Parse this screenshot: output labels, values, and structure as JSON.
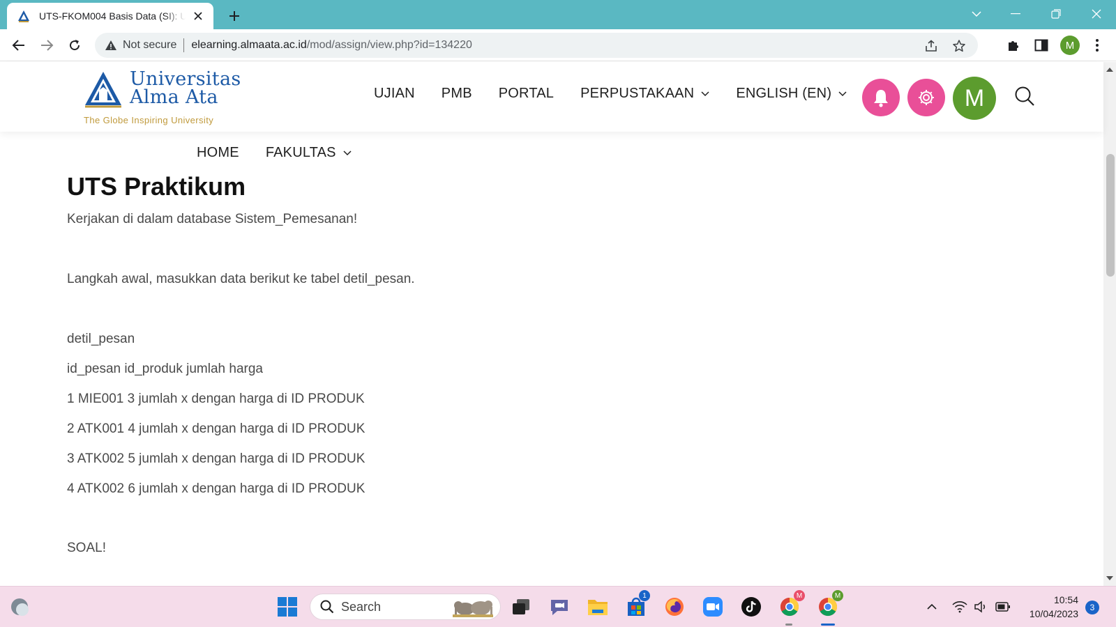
{
  "browser": {
    "tab_title": "UTS-FKOM004 Basis Data (SI): UTS Praktikum",
    "security_label": "Not secure",
    "url_host": "elearning.almaata.ac.id",
    "url_path": "/mod/assign/view.php?id=134220",
    "profile_initial": "M"
  },
  "site": {
    "logo_line1": "Universitas",
    "logo_line2": "Alma Ata",
    "logo_tagline": "The Globe Inspiring University",
    "nav": [
      {
        "label": "UJIAN"
      },
      {
        "label": "PMB"
      },
      {
        "label": "PORTAL"
      },
      {
        "label": "PERPUSTAKAAN"
      },
      {
        "label": "ENGLISH (EN)"
      }
    ],
    "user_initial": "M",
    "subnav": [
      {
        "label": "HOME"
      },
      {
        "label": "FAKULTAS"
      }
    ],
    "colors": {
      "accent_pink": "#e94f98",
      "avatar_green": "#5c9c2e",
      "brand_blue": "#1d5aa6"
    }
  },
  "content": {
    "title": "UTS Praktikum",
    "paragraphs": [
      "Kerjakan di dalam database Sistem_Pemesanan!",
      "Langkah awal, masukkan data berikut ke tabel detil_pesan.",
      "detil_pesan",
      "id_pesan  id_produk  jumlah  harga",
      "1 MIE001  3 jumlah x dengan harga di ID PRODUK",
      "2 ATK001 4 jumlah x dengan harga di ID PRODUK",
      "3 ATK002 5 jumlah x dengan harga di ID PRODUK",
      "4 ATK002  6 jumlah x dengan harga di ID PRODUK",
      "SOAL!"
    ]
  },
  "taskbar": {
    "search_label": "Search",
    "store_badge": "1",
    "chrome_badge1": "M",
    "chrome_badge2": "M",
    "time": "10:54",
    "date": "10/04/2023",
    "notifications": "3"
  }
}
